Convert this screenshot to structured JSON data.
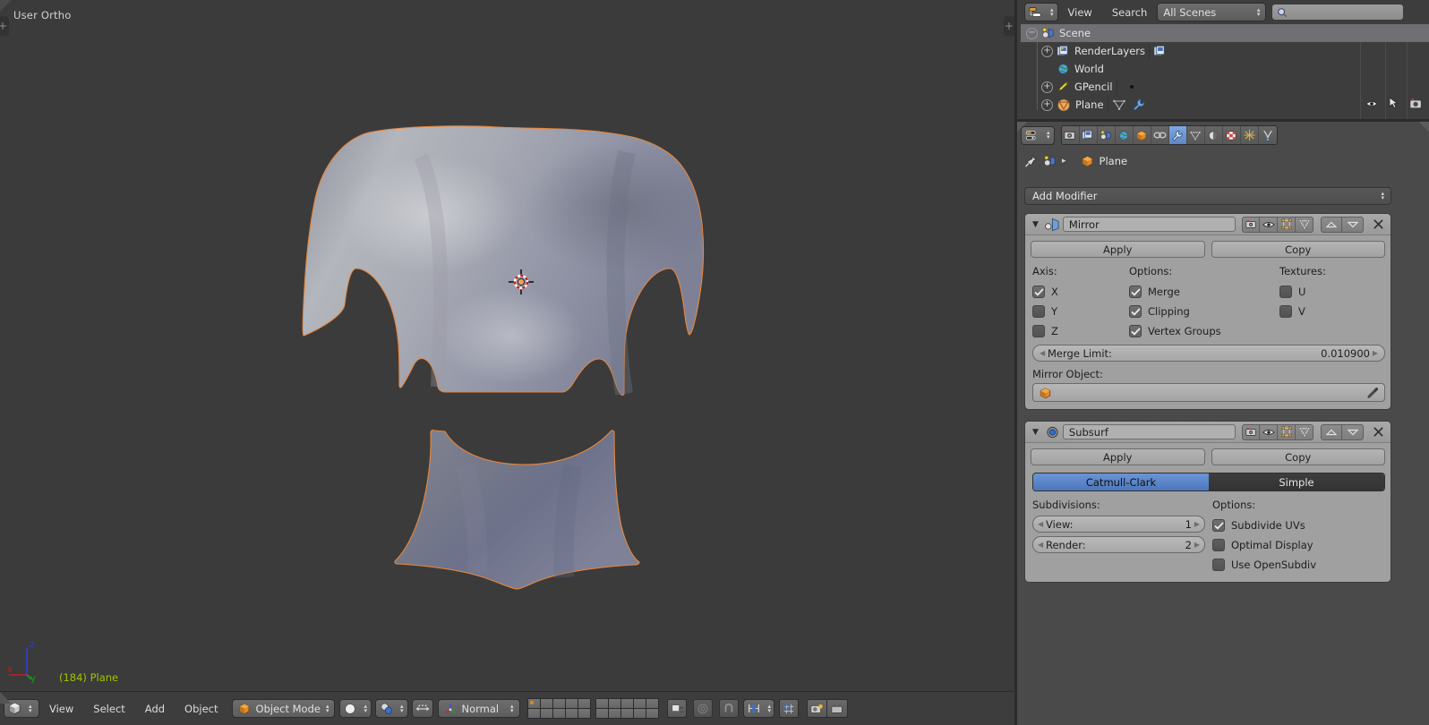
{
  "app": "Blender",
  "viewport": {
    "header_text": "User Ortho",
    "object_label": "(184) Plane",
    "axis": {
      "x": "x",
      "y": "y",
      "z": "z"
    },
    "background_color": "#3b3b3b",
    "outline_color": "#e8873b",
    "cursor_icon": "3d-cursor-icon"
  },
  "viewport_footer": {
    "editor_type_icon": "editor-type-3dview-icon",
    "menus": [
      "View",
      "Select",
      "Add",
      "Object"
    ],
    "mode": {
      "label": "Object Mode",
      "icon": "object-mode-icon"
    },
    "shading": {
      "icon": "shading-solid-icon"
    },
    "pivot": {
      "icon": "pivot-median-point-icon"
    },
    "manipulator_toggle_icon": "manipulator-translate-icon",
    "transform_orientation": {
      "label": "Normal",
      "icon": "orientation-axis-icon"
    },
    "layers": {
      "block1_active_index": 0,
      "block1_cells": 10,
      "block2_cells": 10
    },
    "extra_icons": [
      "lock-object-modes-icon",
      "proportional-edit-icon",
      "snap-magnet-icon",
      "snap-target-icon",
      "snap-element-increment-icon",
      "render-opengl-viewport-icon",
      "render-opengl-animation-icon"
    ]
  },
  "outliner": {
    "header": {
      "display_mode_icon": "outliner-display-mode-icon",
      "menus": [
        "View",
        "Search"
      ],
      "scene_filter": "All Scenes",
      "search_placeholder": "",
      "search_icon": "search-icon"
    },
    "column_icons": [
      "eye-icon",
      "cursor-arrow-icon",
      "camera-icon"
    ],
    "rows": [
      {
        "label": "Scene",
        "icon": "scene-icon",
        "expander": "collapse",
        "indent": 0,
        "selected": true,
        "badges": []
      },
      {
        "label": "RenderLayers",
        "icon": "renderlayers-icon",
        "expander": "expand",
        "indent": 1,
        "selected": false,
        "badges": [
          "renderlayers-icon"
        ]
      },
      {
        "label": "World",
        "icon": "world-icon",
        "expander": "none",
        "indent": 1,
        "selected": false,
        "badges": []
      },
      {
        "label": "GPencil",
        "icon": "gpencil-icon",
        "expander": "expand",
        "indent": 1,
        "selected": false,
        "badges": [
          "dot"
        ]
      },
      {
        "label": "Plane",
        "icon": "mesh-object-icon",
        "expander": "expand",
        "indent": 1,
        "selected": false,
        "badges": [
          "mesh-data-icon",
          "wrench-icon"
        ]
      }
    ]
  },
  "properties": {
    "tabs": [
      {
        "name": "render-tab",
        "icon": "camera-back-icon",
        "active": false
      },
      {
        "name": "render-layers-tab",
        "icon": "renderlayers-icon",
        "active": false
      },
      {
        "name": "scene-tab",
        "icon": "scene-icon",
        "active": false
      },
      {
        "name": "world-tab",
        "icon": "world-icon",
        "active": false
      },
      {
        "name": "object-tab",
        "icon": "object-cube-icon",
        "active": false
      },
      {
        "name": "constraints-tab",
        "icon": "chain-link-icon",
        "active": false
      },
      {
        "name": "modifiers-tab",
        "icon": "wrench-icon",
        "active": true
      },
      {
        "name": "data-tab",
        "icon": "mesh-data-triangle-icon",
        "active": false
      },
      {
        "name": "material-tab",
        "icon": "material-sphere-icon",
        "active": false
      },
      {
        "name": "texture-tab",
        "icon": "texture-checker-icon",
        "active": false
      },
      {
        "name": "particles-tab",
        "icon": "particles-icon",
        "active": false
      },
      {
        "name": "physics-tab",
        "icon": "physics-icon",
        "active": false
      }
    ],
    "breadcrumb": {
      "pin_icon": "pin-icon",
      "scene_icon": "scene-icon",
      "separator": "▸",
      "object_icon": "object-cube-icon",
      "object_name": "Plane"
    },
    "add_modifier_label": "Add Modifier",
    "modifiers": [
      {
        "name": "Mirror",
        "type_icon": "modifier-mirror-icon",
        "collapse_icon": "chevron-down-icon",
        "header_toggles": [
          "render-camera-icon",
          "realtime-eye-icon",
          "editmode-icon",
          "oncage-icon"
        ],
        "move_up_icon": "triangle-up-icon",
        "move_down_icon": "triangle-down-icon",
        "close_icon": "x-icon",
        "apply_label": "Apply",
        "copy_label": "Copy",
        "columns": {
          "axis": {
            "title": "Axis:",
            "items": [
              {
                "label": "X",
                "checked": true
              },
              {
                "label": "Y",
                "checked": false
              },
              {
                "label": "Z",
                "checked": false
              }
            ]
          },
          "options": {
            "title": "Options:",
            "items": [
              {
                "label": "Merge",
                "checked": true
              },
              {
                "label": "Clipping",
                "checked": true
              },
              {
                "label": "Vertex Groups",
                "checked": true
              }
            ]
          },
          "textures": {
            "title": "Textures:",
            "items": [
              {
                "label": "U",
                "checked": false
              },
              {
                "label": "V",
                "checked": false
              }
            ]
          }
        },
        "merge_limit": {
          "label": "Merge Limit:",
          "value": "0.010900"
        },
        "mirror_object": {
          "label": "Mirror Object:",
          "value": "",
          "icon": "object-cube-icon",
          "picker_icon": "eyedropper-icon"
        }
      },
      {
        "name": "Subsurf",
        "type_icon": "modifier-subsurf-icon",
        "collapse_icon": "chevron-down-icon",
        "header_toggles": [
          "render-camera-icon",
          "realtime-eye-icon",
          "editmode-icon",
          "oncage-icon"
        ],
        "move_up_icon": "triangle-up-icon",
        "move_down_icon": "triangle-down-icon",
        "close_icon": "x-icon",
        "apply_label": "Apply",
        "copy_label": "Copy",
        "subdivision_type": {
          "options": [
            "Catmull-Clark",
            "Simple"
          ],
          "selected": "Catmull-Clark"
        },
        "subdivisions": {
          "title": "Subdivisions:",
          "view": {
            "label": "View:",
            "value": "1"
          },
          "render": {
            "label": "Render:",
            "value": "2"
          }
        },
        "options": {
          "title": "Options:",
          "items": [
            {
              "label": "Subdivide UVs",
              "checked": true
            },
            {
              "label": "Optimal Display",
              "checked": false
            },
            {
              "label": "Use OpenSubdiv",
              "checked": false
            }
          ]
        }
      }
    ]
  },
  "colors": {
    "accent_blue": "#5680c2",
    "mesh_outline": "#e8873b",
    "object_name_green": "#9ec400",
    "panel_gray": "#a0a0a0",
    "editor_gray": "#4a4a4a",
    "viewport_gray": "#3b3b3b"
  }
}
